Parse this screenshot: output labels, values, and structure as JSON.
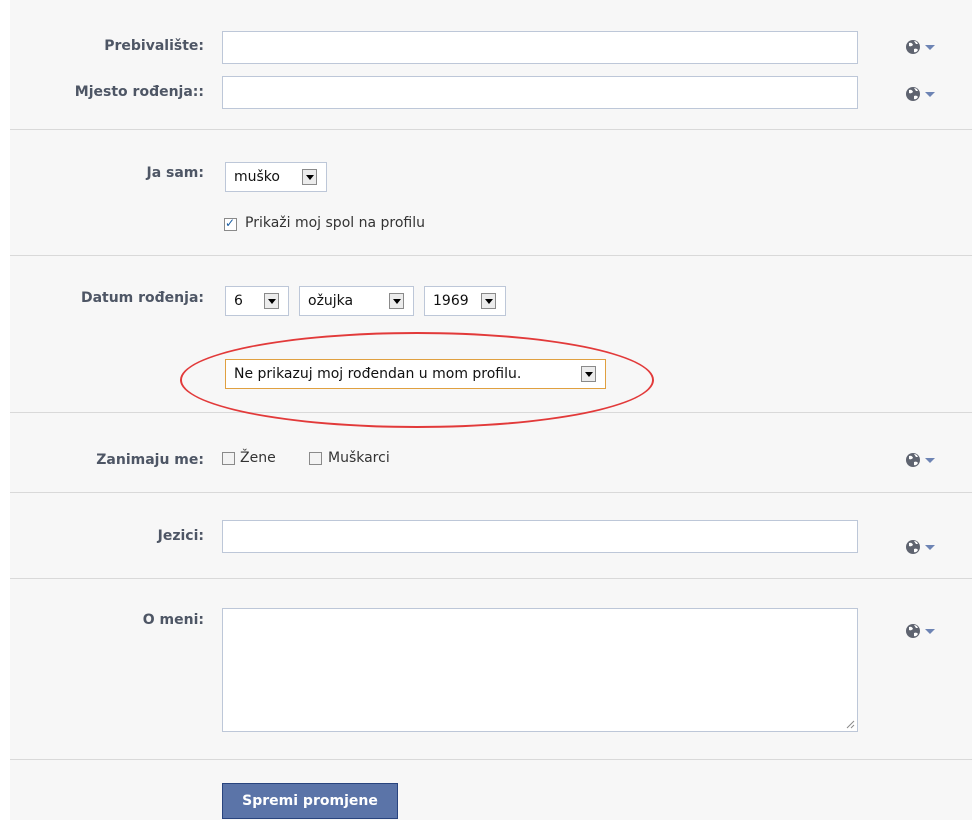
{
  "fields": {
    "prebivaliste_label": "Prebivalište:",
    "mjesto_rodenja_label": "Mjesto rođenja::",
    "prebivaliste_value": "",
    "mjesto_rodenja_value": ""
  },
  "gender": {
    "label": "Ja sam:",
    "selected": "muško",
    "show_on_profile_label": "Prikaži moj spol na profilu",
    "show_on_profile_checked": true
  },
  "birthday": {
    "label": "Datum rođenja:",
    "day": "6",
    "month": "ožujka",
    "year": "1969",
    "visibility": "Ne prikazuj moj rođendan u mom profilu."
  },
  "interested_in": {
    "label": "Zanimaju me:",
    "women_label": "Žene",
    "men_label": "Muškarci",
    "women_checked": false,
    "men_checked": false
  },
  "languages": {
    "label": "Jezici:",
    "value": ""
  },
  "about": {
    "label": "O meni:",
    "value": ""
  },
  "actions": {
    "save_label": "Spremi promjene"
  },
  "icons": {
    "privacy": "globe-privacy-icon",
    "dropdown": "chevron-down-icon",
    "checkmark": "checkmark-icon"
  },
  "colors": {
    "label_text": "#4e5665",
    "section_bg": "#f7f7f7",
    "input_border": "#bdc7d8",
    "button_bg": "#5b74a8",
    "highlight_ellipse": "#e23a3a",
    "focus_border": "#e0a040"
  }
}
